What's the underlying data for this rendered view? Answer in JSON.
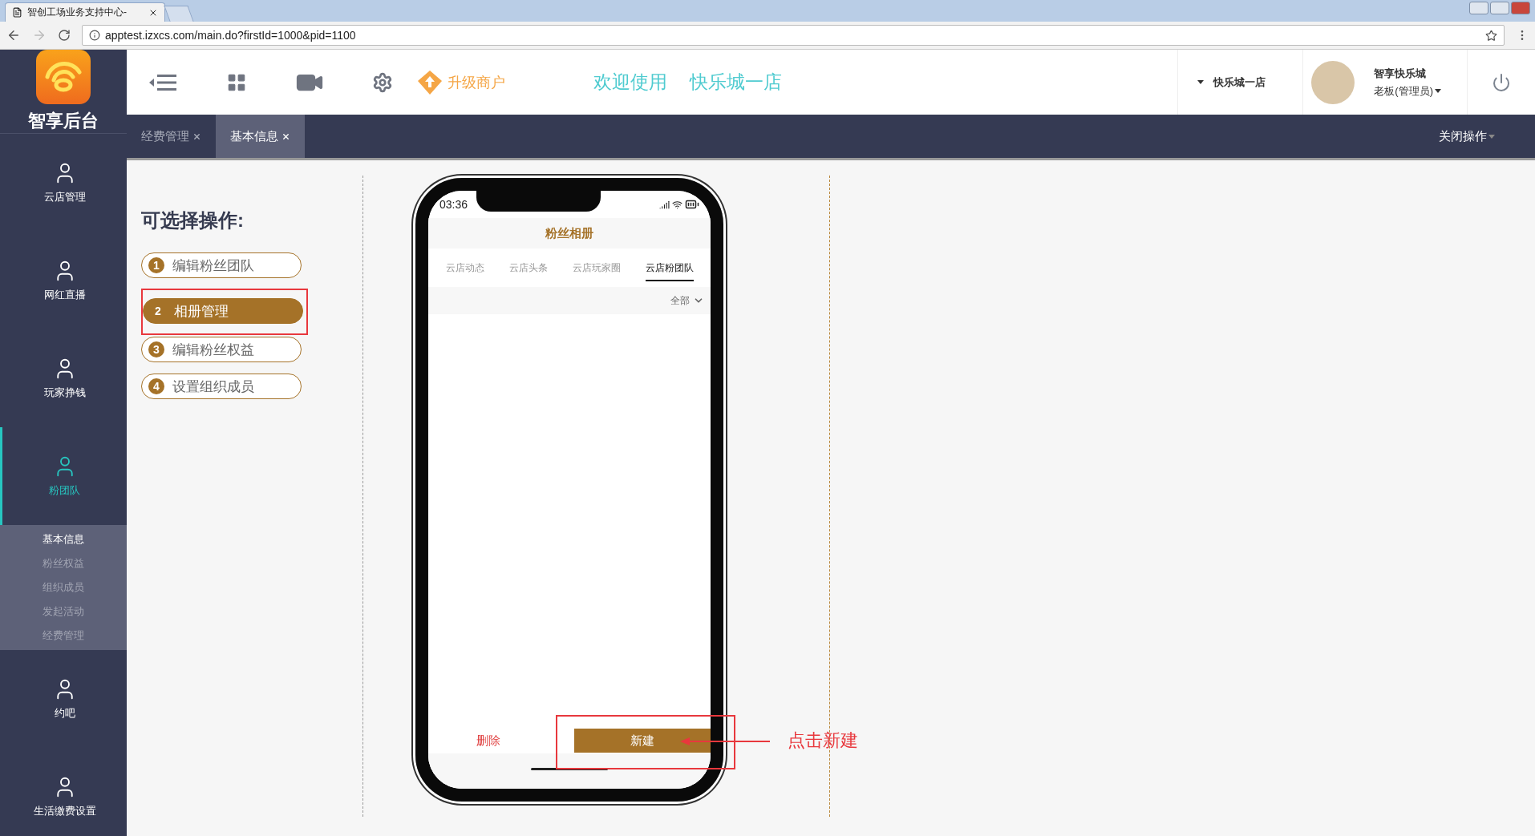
{
  "browser": {
    "tab_title": "智创工场业务支持中心-",
    "address": "apptest.izxcs.com/main.do?firstId=1000&pid=1100"
  },
  "logo": {
    "text": "智享后台"
  },
  "toolbar": {
    "upgrade": "升级商户",
    "welcome": "欢迎使用",
    "store": "快乐城一店"
  },
  "store_select": {
    "value": "快乐城一店"
  },
  "user": {
    "name": "智享快乐城",
    "role": "老板(管理员)"
  },
  "tabs": [
    {
      "label": "经费管理",
      "selected": false
    },
    {
      "label": "基本信息",
      "selected": true
    }
  ],
  "close_ops": "关闭操作",
  "sidebar": {
    "items": [
      {
        "label": "云店管理",
        "selected": false
      },
      {
        "label": "网红直播",
        "selected": false
      },
      {
        "label": "玩家挣钱",
        "selected": false
      },
      {
        "label": "粉团队",
        "selected": true,
        "children": [
          {
            "label": "基本信息",
            "selected": true
          },
          {
            "label": "粉丝权益",
            "selected": false
          },
          {
            "label": "组织成员",
            "selected": false
          },
          {
            "label": "发起活动",
            "selected": false
          },
          {
            "label": "经费管理",
            "selected": false
          }
        ]
      },
      {
        "label": "约吧",
        "selected": false
      },
      {
        "label": "生活缴费设置",
        "selected": false
      }
    ]
  },
  "operations": {
    "title": "可选择操作:",
    "items": [
      {
        "number": "1",
        "label": "编辑粉丝团队",
        "selected": false
      },
      {
        "number": "2",
        "label": "相册管理",
        "selected": true
      },
      {
        "number": "3",
        "label": "编辑粉丝权益",
        "selected": false
      },
      {
        "number": "4",
        "label": "设置组织成员",
        "selected": false
      }
    ]
  },
  "phone": {
    "time": "03:36",
    "title": "粉丝相册",
    "tabs": [
      {
        "label": "云店动态",
        "selected": false
      },
      {
        "label": "云店头条",
        "selected": false
      },
      {
        "label": "云店玩家圈",
        "selected": false
      },
      {
        "label": "云店粉团队",
        "selected": true
      }
    ],
    "filter": "全部",
    "delete": "删除",
    "create": "新建"
  },
  "annotation": "点击新建"
}
